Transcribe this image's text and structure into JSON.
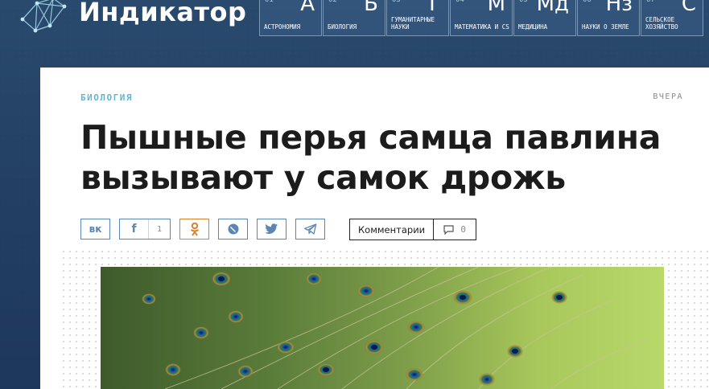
{
  "site": {
    "brand": "Индикатор"
  },
  "rubrics": [
    {
      "num": "01",
      "symbol": "А",
      "label": "Астрономия"
    },
    {
      "num": "02",
      "symbol": "Б",
      "label": "Биология"
    },
    {
      "num": "03",
      "symbol": "Г",
      "label": "Гуманитарные науки"
    },
    {
      "num": "04",
      "symbol": "М",
      "label": "Математика и CS"
    },
    {
      "num": "05",
      "symbol": "Мд",
      "label": "Медицина"
    },
    {
      "num": "06",
      "symbol": "Нз",
      "label": "Науки о Земле"
    },
    {
      "num": "07",
      "symbol": "С",
      "label": "Сельское хозяйство"
    }
  ],
  "article": {
    "category": "БИОЛОГИЯ",
    "date": "ВЧЕРА",
    "title": "Пышные перья самца павлина вызывают у самок дрожь"
  },
  "share": {
    "buttons": [
      {
        "network": "vk",
        "icon": "vk-icon",
        "label": "вк"
      },
      {
        "network": "facebook",
        "icon": "facebook-icon",
        "label": "f",
        "count": "1"
      },
      {
        "network": "odnoklassniki",
        "icon": "odnoklassniki-icon"
      },
      {
        "network": "livejournal",
        "icon": "livejournal-icon"
      },
      {
        "network": "twitter",
        "icon": "twitter-icon"
      },
      {
        "network": "telegram",
        "icon": "telegram-icon"
      }
    ],
    "comments_label": "Комментарии",
    "comments_count": "0"
  },
  "colors": {
    "header_bg": "#2e4f74",
    "accent_category": "#62b6cf",
    "share_border": "#5b86b3",
    "odnoklassniki": "#d9822b"
  }
}
